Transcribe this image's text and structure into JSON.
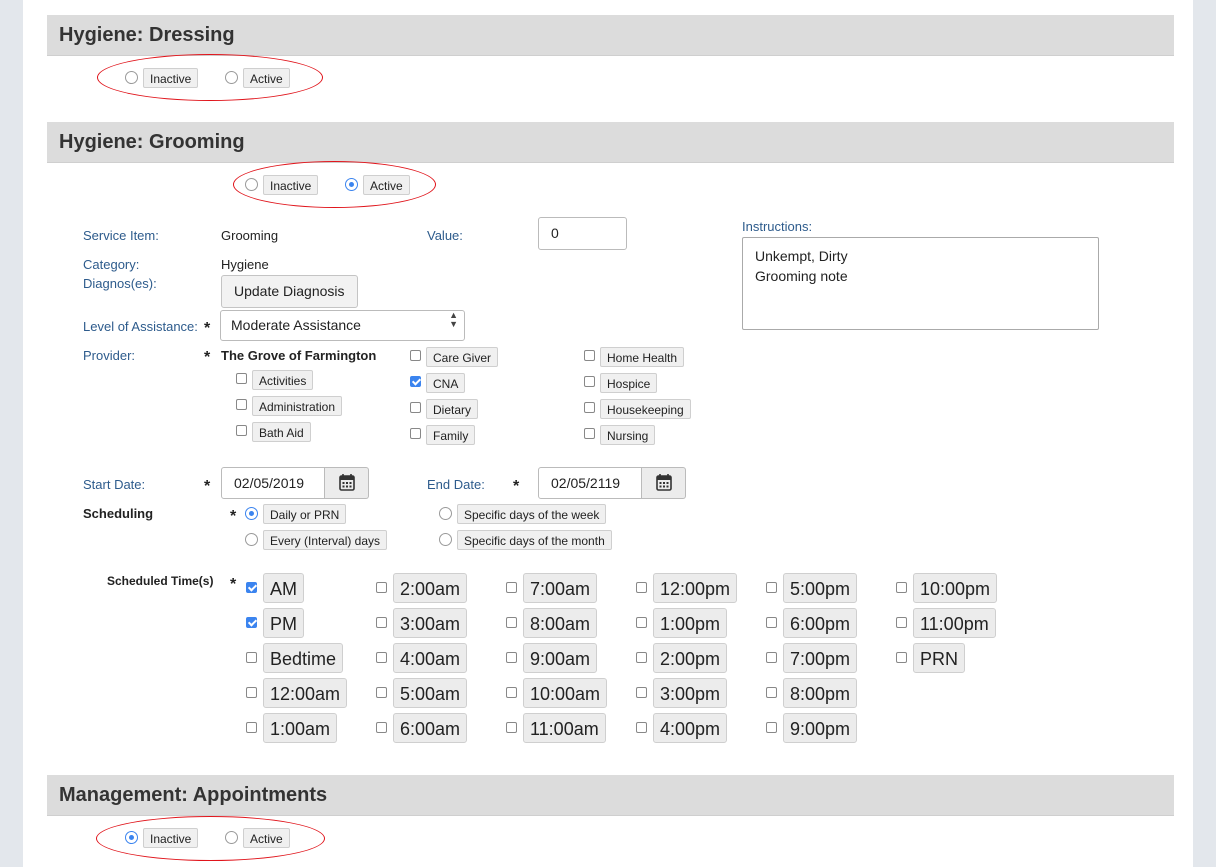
{
  "sections": {
    "dressing": {
      "title": "Hygiene: Dressing",
      "inactive_label": "Inactive",
      "active_label": "Active",
      "selected": "none"
    },
    "grooming": {
      "title": "Hygiene: Grooming",
      "inactive_label": "Inactive",
      "active_label": "Active",
      "selected": "active"
    },
    "appointments": {
      "title": "Management: Appointments",
      "inactive_label": "Inactive",
      "active_label": "Active",
      "selected": "inactive"
    }
  },
  "form": {
    "service_item_label": "Service Item:",
    "service_item_value": "Grooming",
    "value_label": "Value:",
    "value_input": "0",
    "instructions_label": "Instructions:",
    "instructions_lines": [
      "Unkempt, Dirty",
      "Grooming note"
    ],
    "category_label": "Category:",
    "category_value": "Hygiene",
    "diagnoses_label": "Diagnos(es):",
    "update_diagnosis_button": "Update Diagnosis",
    "level_label": "Level of Assistance:",
    "level_value": "Moderate Assistance",
    "provider_label": "Provider:",
    "provider_name": "The Grove of Farmington",
    "required_mark": "*",
    "providers": {
      "activities": {
        "label": "Activities",
        "checked": false
      },
      "administration": {
        "label": "Administration",
        "checked": false
      },
      "bath_aid": {
        "label": "Bath Aid",
        "checked": false
      },
      "care_giver": {
        "label": "Care Giver",
        "checked": false
      },
      "cna": {
        "label": "CNA",
        "checked": true
      },
      "dietary": {
        "label": "Dietary",
        "checked": false
      },
      "family": {
        "label": "Family",
        "checked": false
      },
      "home_health": {
        "label": "Home Health",
        "checked": false
      },
      "hospice": {
        "label": "Hospice",
        "checked": false
      },
      "housekeeping": {
        "label": "Housekeeping",
        "checked": false
      },
      "nursing": {
        "label": "Nursing",
        "checked": false
      }
    },
    "start_date_label": "Start Date:",
    "start_date_value": "02/05/2019",
    "end_date_label": "End Date:",
    "end_date_value": "02/05/2119",
    "scheduling_label": "Scheduling",
    "scheduling_options": {
      "daily": "Daily or PRN",
      "interval": "Every (Interval) days",
      "week": "Specific days of the week",
      "month": "Specific days of the month"
    },
    "scheduling_selected": "daily",
    "scheduled_times_label": "Scheduled Time(s)",
    "times": {
      "am": {
        "label": "AM",
        "checked": true
      },
      "pm": {
        "label": "PM",
        "checked": true
      },
      "bedtime": {
        "label": "Bedtime",
        "checked": false
      },
      "t1200am": {
        "label": "12:00am",
        "checked": false
      },
      "t100am": {
        "label": "1:00am",
        "checked": false
      },
      "t200am": {
        "label": "2:00am",
        "checked": false
      },
      "t300am": {
        "label": "3:00am",
        "checked": false
      },
      "t400am": {
        "label": "4:00am",
        "checked": false
      },
      "t500am": {
        "label": "5:00am",
        "checked": false
      },
      "t600am": {
        "label": "6:00am",
        "checked": false
      },
      "t700am": {
        "label": "7:00am",
        "checked": false
      },
      "t800am": {
        "label": "8:00am",
        "checked": false
      },
      "t900am": {
        "label": "9:00am",
        "checked": false
      },
      "t1000am": {
        "label": "10:00am",
        "checked": false
      },
      "t1100am": {
        "label": "11:00am",
        "checked": false
      },
      "t1200pm": {
        "label": "12:00pm",
        "checked": false
      },
      "t100pm": {
        "label": "1:00pm",
        "checked": false
      },
      "t200pm": {
        "label": "2:00pm",
        "checked": false
      },
      "t300pm": {
        "label": "3:00pm",
        "checked": false
      },
      "t400pm": {
        "label": "4:00pm",
        "checked": false
      },
      "t500pm": {
        "label": "5:00pm",
        "checked": false
      },
      "t600pm": {
        "label": "6:00pm",
        "checked": false
      },
      "t700pm": {
        "label": "7:00pm",
        "checked": false
      },
      "t800pm": {
        "label": "8:00pm",
        "checked": false
      },
      "t900pm": {
        "label": "9:00pm",
        "checked": false
      },
      "t1000pm": {
        "label": "10:00pm",
        "checked": false
      },
      "t1100pm": {
        "label": "11:00pm",
        "checked": false
      },
      "prn": {
        "label": "PRN",
        "checked": false
      }
    }
  },
  "colors": {
    "accent": "#3b84ef",
    "annotation": "#e0141b",
    "label_blue": "#2d5b8c",
    "header_bg": "#dcdcdc"
  },
  "icons": {
    "calendar": "calendar-icon",
    "select_arrows": "chevron-updown-icon"
  }
}
